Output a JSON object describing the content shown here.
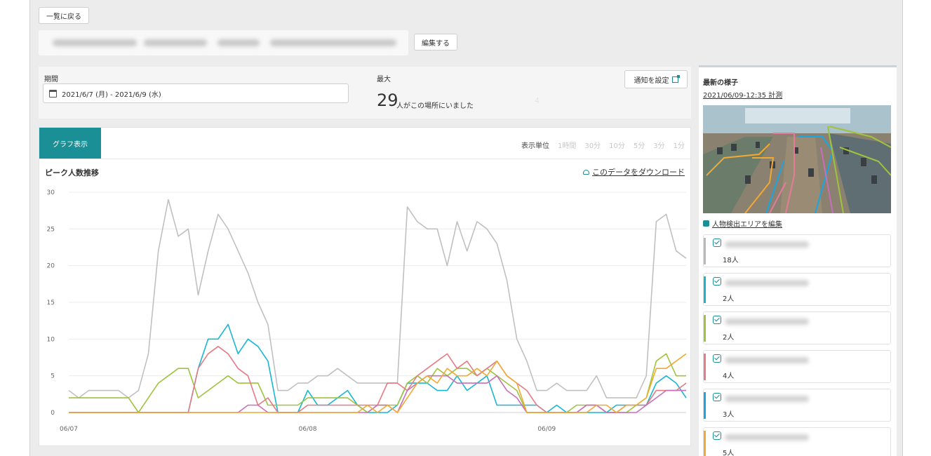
{
  "nav": {
    "back_label": "一覧に戻る"
  },
  "header": {
    "edit_label": "編集する"
  },
  "period": {
    "label": "期間",
    "value": "2021/6/7 (月) - 2021/6/9 (水)",
    "max_label": "最大",
    "max_value": "29",
    "max_suffix": "人がこの場所にいました",
    "faint_number": "4",
    "notify_label": "通知を設定"
  },
  "graph": {
    "tab_label": "グラフ表示",
    "unit_label": "表示単位",
    "unit_options": [
      "1時間",
      "30分",
      "10分",
      "5分",
      "3分",
      "1分"
    ],
    "title": "ピーク人数推移",
    "download_label": "このデータをダウンロード"
  },
  "chart_data": {
    "type": "line",
    "x_labels": [
      "06/07",
      "06/08",
      "06/09"
    ],
    "x_label_index": [
      0,
      24,
      48
    ],
    "ylim": [
      0,
      30
    ],
    "yticks": [
      0,
      5,
      10,
      15,
      20,
      25,
      30
    ],
    "grid": true,
    "series": [
      {
        "color": "#c0c0c0",
        "values": [
          3,
          2,
          3,
          3,
          3,
          3,
          2,
          3,
          8,
          22,
          29,
          24,
          25,
          16,
          22,
          27,
          25,
          22,
          19,
          15,
          12,
          3,
          3,
          4,
          4,
          5,
          5,
          6,
          5,
          4,
          4,
          4,
          4,
          4,
          28,
          26,
          25,
          25,
          20,
          26,
          22,
          26,
          25,
          23,
          18,
          10,
          7,
          3,
          3,
          4,
          3,
          3,
          3,
          5,
          2,
          2,
          2,
          2,
          5,
          26,
          27,
          22,
          21
        ]
      },
      {
        "color": "#19b6d2",
        "values": [
          0,
          0,
          0,
          0,
          0,
          0,
          0,
          0,
          0,
          0,
          0,
          0,
          0,
          6,
          10,
          10,
          12,
          8,
          10,
          9,
          7,
          0,
          0,
          0,
          3,
          1,
          1,
          2,
          3,
          1,
          0,
          0,
          0,
          1,
          4,
          4,
          4,
          3,
          3,
          5,
          3,
          4,
          5,
          1,
          1,
          1,
          1,
          1,
          0,
          1,
          0,
          0,
          0,
          0,
          0,
          1,
          1,
          1,
          1,
          4,
          5,
          4,
          2
        ]
      },
      {
        "color": "#9dc43c",
        "values": [
          2,
          2,
          2,
          2,
          2,
          2,
          2,
          0,
          2,
          4,
          5,
          6,
          6,
          2,
          3,
          4,
          5,
          4,
          4,
          4,
          1,
          1,
          1,
          1,
          2,
          2,
          2,
          2,
          2,
          1,
          0,
          1,
          1,
          1,
          4,
          5,
          4,
          6,
          5,
          6,
          6,
          5,
          6,
          5,
          4,
          3,
          0,
          0,
          0,
          0,
          0,
          1,
          1,
          1,
          0,
          0,
          0,
          1,
          2,
          7,
          8,
          5,
          5
        ]
      },
      {
        "color": "#e57b84",
        "values": [
          0,
          0,
          0,
          0,
          0,
          0,
          0,
          0,
          0,
          0,
          0,
          0,
          0,
          6,
          8,
          9,
          8,
          6,
          5,
          1,
          2,
          0,
          0,
          0,
          1,
          1,
          1,
          1,
          1,
          1,
          1,
          1,
          4,
          4,
          3,
          5,
          6,
          7,
          8,
          6,
          7,
          5,
          6,
          7,
          5,
          4,
          3,
          1,
          0,
          0,
          0,
          0,
          1,
          1,
          0,
          0,
          1,
          1,
          1,
          3,
          3,
          3,
          4
        ]
      },
      {
        "color": "#c76fb8",
        "values": [
          0,
          0,
          0,
          0,
          0,
          0,
          0,
          0,
          0,
          0,
          0,
          0,
          0,
          0,
          0,
          0,
          0,
          0,
          1,
          1,
          0,
          0,
          0,
          0,
          0,
          0,
          0,
          0,
          0,
          0,
          0,
          1,
          1,
          0,
          3,
          4,
          5,
          5,
          5,
          4,
          4,
          4,
          4,
          5,
          3,
          2,
          0,
          0,
          0,
          0,
          0,
          0,
          1,
          1,
          0,
          0,
          0,
          0,
          1,
          2,
          3,
          3,
          3
        ]
      },
      {
        "color": "#f2a933",
        "values": [
          0,
          0,
          0,
          0,
          0,
          0,
          0,
          0,
          0,
          0,
          0,
          0,
          0,
          0,
          0,
          0,
          0,
          0,
          0,
          0,
          0,
          0,
          0,
          0,
          0,
          0,
          0,
          0,
          0,
          0,
          1,
          0,
          1,
          0,
          2,
          4,
          5,
          4,
          6,
          5,
          5,
          6,
          5,
          7,
          5,
          4,
          0,
          0,
          0,
          0,
          0,
          0,
          0,
          1,
          1,
          0,
          1,
          1,
          2,
          6,
          6,
          7,
          8
        ]
      }
    ]
  },
  "latest": {
    "title": "最新の様子",
    "timestamp": "2021/06/09-12:35 計測",
    "edit_area_label": "人物検出エリアを編集"
  },
  "areas": [
    {
      "count": "18人",
      "color": "#b9b9b9"
    },
    {
      "count": "2人",
      "color": "#19b6c8"
    },
    {
      "count": "2人",
      "color": "#9dc43c"
    },
    {
      "count": "4人",
      "color": "#e57b84"
    },
    {
      "count": "3人",
      "color": "#1aa6e0"
    },
    {
      "count": "5人",
      "color": "#f2a933"
    }
  ]
}
